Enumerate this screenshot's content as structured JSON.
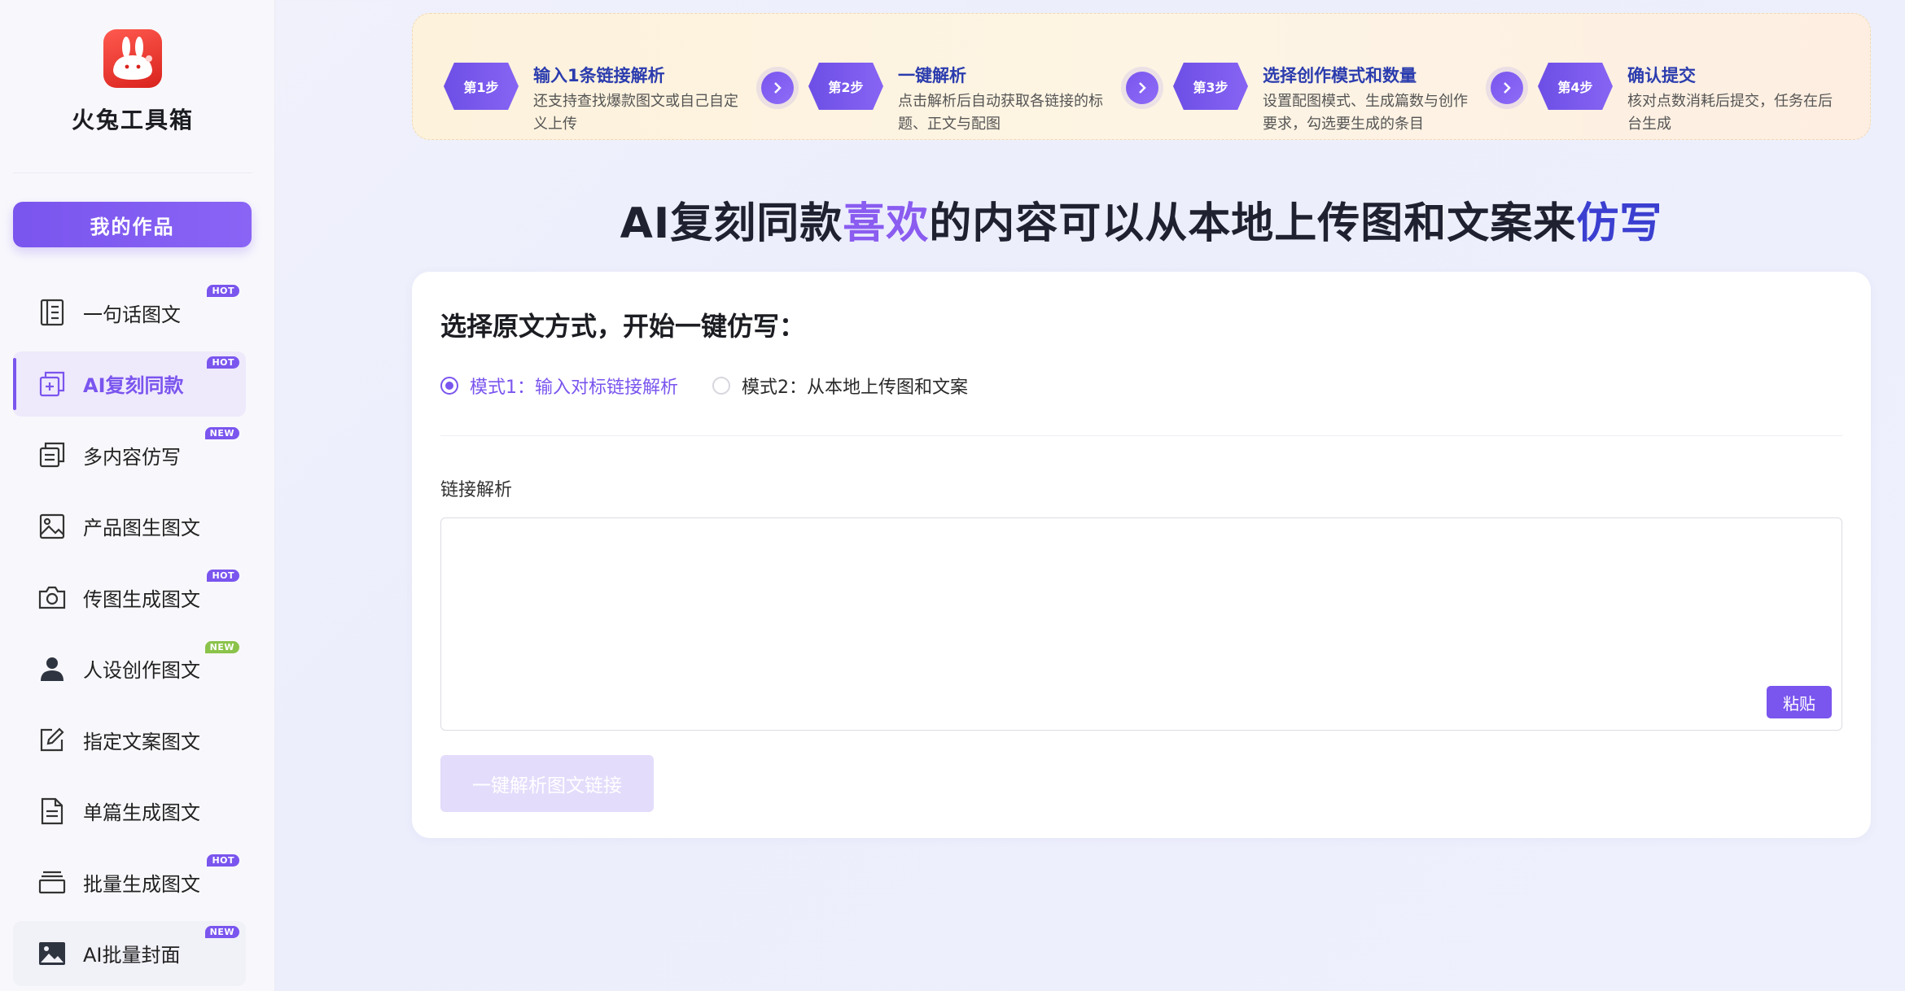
{
  "brand": {
    "name": "火兔工具箱",
    "accent": "#7a55ee"
  },
  "sidebar": {
    "my_works_label": "我的作品",
    "items": [
      {
        "label": "一句话图文",
        "badge": "HOT"
      },
      {
        "label": "AI复刻同款",
        "badge": "HOT",
        "active": true
      },
      {
        "label": "多内容仿写",
        "badge": "NEW"
      },
      {
        "label": "产品图生图文",
        "badge": ""
      },
      {
        "label": "传图生成图文",
        "badge": "HOT"
      },
      {
        "label": "人设创作图文",
        "badge": "NEW"
      },
      {
        "label": "指定文案图文",
        "badge": ""
      },
      {
        "label": "单篇生成图文",
        "badge": ""
      },
      {
        "label": "批量生成图文",
        "badge": "HOT"
      },
      {
        "label": "AI批量封面",
        "badge": "NEW"
      }
    ]
  },
  "steps": [
    {
      "tag": "第1步",
      "title": "输入1条链接解析",
      "desc": "还支持查找爆款图文或自己自定义上传"
    },
    {
      "tag": "第2步",
      "title": "一键解析",
      "desc": "点击解析后自动获取各链接的标题、正文与配图"
    },
    {
      "tag": "第3步",
      "title": "选择创作模式和数量",
      "desc": "设置配图模式、生成篇数与创作要求，勾选要生成的条目"
    },
    {
      "tag": "第4步",
      "title": "确认提交",
      "desc": "核对点数消耗后提交，任务在后台生成"
    }
  ],
  "headline": {
    "part1": "AI复刻同款",
    "highlight1": "喜欢",
    "part2": "的内容可以从本地上传图和文案来",
    "highlight2": "仿写"
  },
  "main": {
    "title": "选择原文方式，开始一键仿写：",
    "modes": [
      {
        "label": "模式1：输入对标链接解析",
        "selected": true
      },
      {
        "label": "模式2：从本地上传图和文案",
        "selected": false
      }
    ],
    "field_label": "链接解析",
    "textarea_value": "",
    "paste_label": "粘贴",
    "parse_label": "一键解析图文链接"
  }
}
